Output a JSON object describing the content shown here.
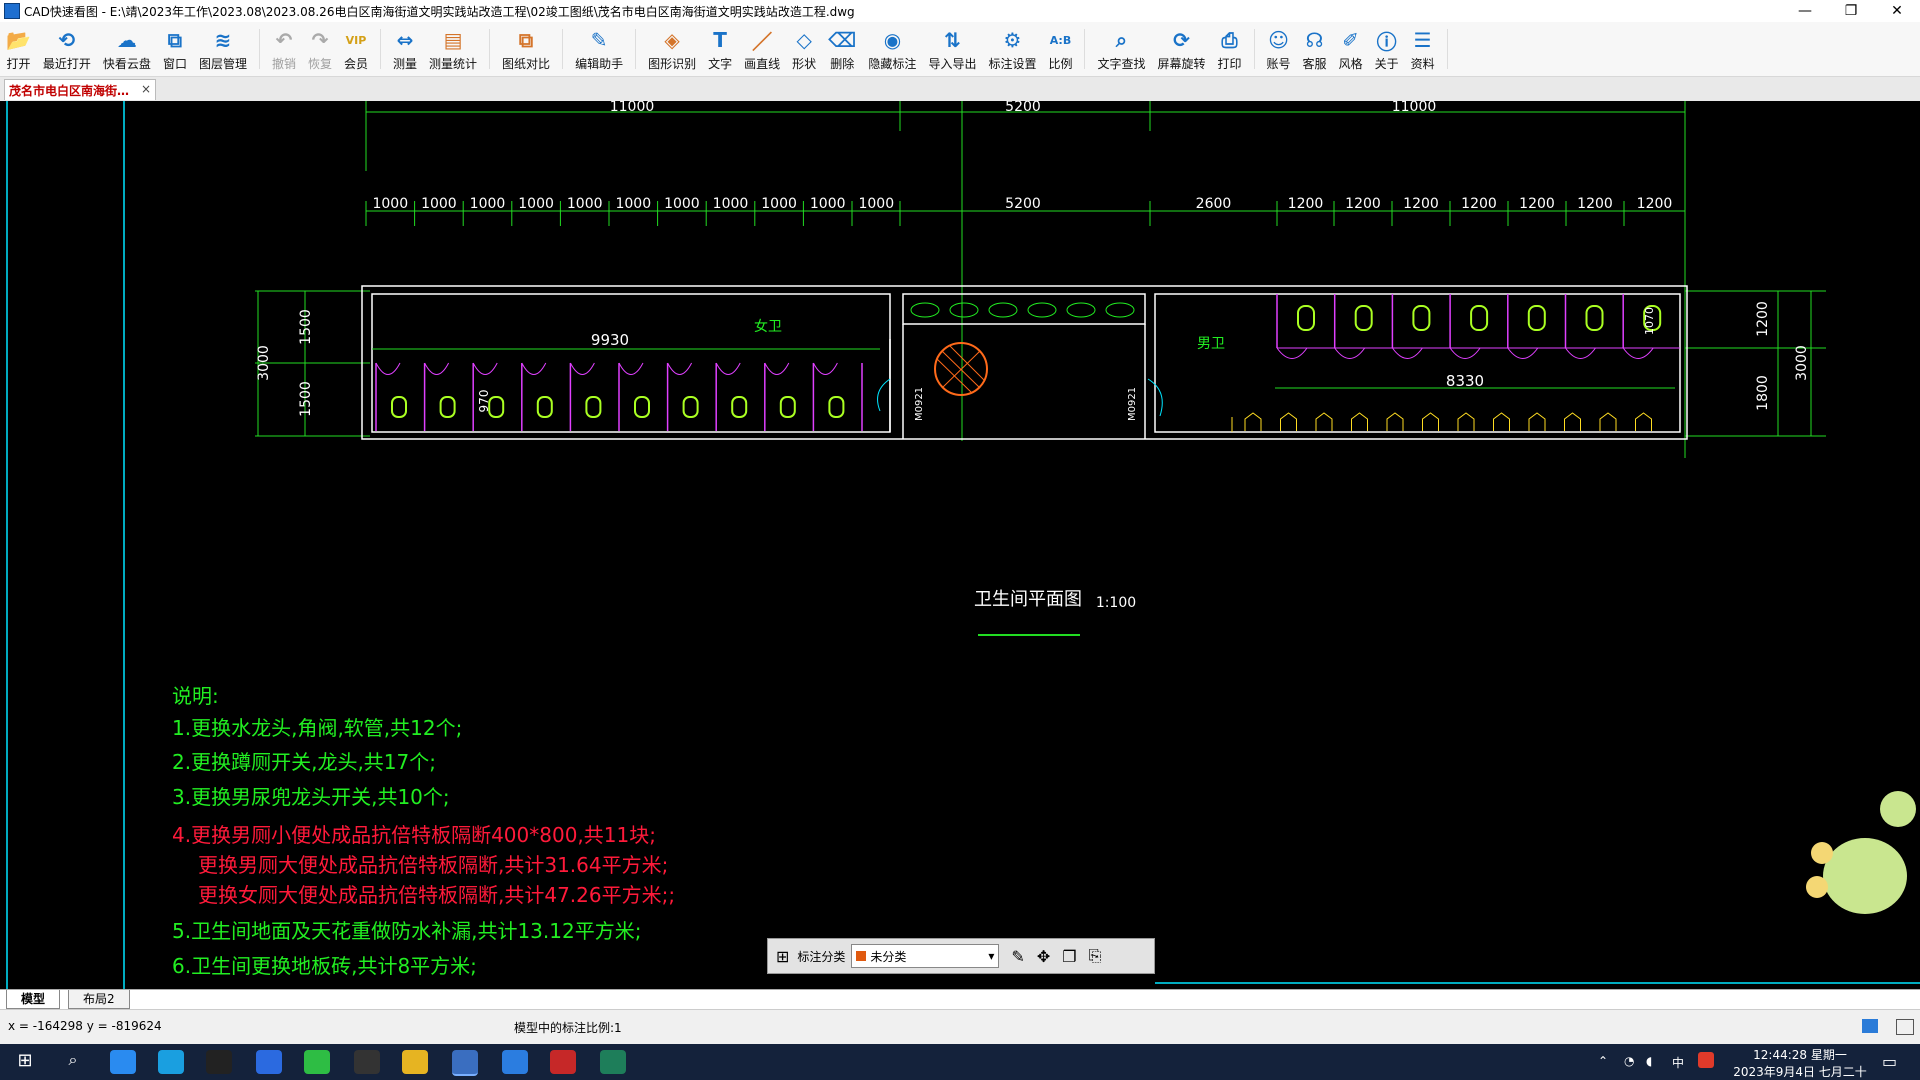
{
  "window": {
    "title": "CAD快速看图 - E:\\靖\\2023年工作\\2023.08\\2023.08.26电白区南海街道文明实践站改造工程\\02竣工图纸\\茂名市电白区南海街道文明实践站改造工程.dwg",
    "minimize": "—",
    "restore": "❐",
    "close": "✕"
  },
  "toolbar": {
    "items": [
      {
        "label": "打开",
        "icon": "folder-open-icon",
        "color": "#1a73c8"
      },
      {
        "label": "最近打开",
        "icon": "recent-icon",
        "color": "#1a73c8"
      },
      {
        "label": "快看云盘",
        "icon": "cloud-icon",
        "color": "#1a73c8"
      },
      {
        "label": "窗口",
        "icon": "window-icon",
        "color": "#1a73c8"
      },
      {
        "label": "图层管理",
        "icon": "layers-icon",
        "color": "#1a73c8"
      },
      {
        "label": "撤销",
        "icon": "undo-icon",
        "color": "#aaaaaa"
      },
      {
        "label": "恢复",
        "icon": "redo-icon",
        "color": "#aaaaaa"
      },
      {
        "label": "会员",
        "icon": "vip-icon",
        "color": "#d4a017"
      },
      {
        "label": "测量",
        "icon": "measure-icon",
        "color": "#1a73c8"
      },
      {
        "label": "测量统计",
        "icon": "measure-stats-icon",
        "color": "#d4742a"
      },
      {
        "label": "图纸对比",
        "icon": "compare-icon",
        "color": "#d4742a"
      },
      {
        "label": "编辑助手",
        "icon": "edit-assistant-icon",
        "color": "#1a73c8"
      },
      {
        "label": "图形识别",
        "icon": "shape-recognize-icon",
        "color": "#d4742a"
      },
      {
        "label": "文字",
        "icon": "text-icon",
        "color": "#1a73c8"
      },
      {
        "label": "画直线",
        "icon": "line-icon",
        "color": "#d4742a"
      },
      {
        "label": "形状",
        "icon": "shape-icon",
        "color": "#1a73c8"
      },
      {
        "label": "删除",
        "icon": "eraser-icon",
        "color": "#1a73c8"
      },
      {
        "label": "隐藏标注",
        "icon": "hide-annotation-icon",
        "color": "#1a73c8"
      },
      {
        "label": "导入导出",
        "icon": "import-export-icon",
        "color": "#1a73c8"
      },
      {
        "label": "标注设置",
        "icon": "annotation-settings-icon",
        "color": "#1a73c8"
      },
      {
        "label": "比例",
        "icon": "scale-icon",
        "color": "#1a73c8"
      },
      {
        "label": "文字查找",
        "icon": "text-search-icon",
        "color": "#1a73c8"
      },
      {
        "label": "屏幕旋转",
        "icon": "screen-rotate-icon",
        "color": "#1a73c8"
      },
      {
        "label": "打印",
        "icon": "print-icon",
        "color": "#1a73c8"
      },
      {
        "label": "账号",
        "icon": "account-icon",
        "color": "#1a73c8"
      },
      {
        "label": "客服",
        "icon": "headset-icon",
        "color": "#1a73c8"
      },
      {
        "label": "风格",
        "icon": "style-icon",
        "color": "#1a73c8"
      },
      {
        "label": "关于",
        "icon": "info-icon",
        "color": "#1a73c8"
      },
      {
        "label": "资料",
        "icon": "docs-icon",
        "color": "#1a73c8"
      }
    ]
  },
  "doc_tab": {
    "label": "茂名市电白区南海街…",
    "close": "×"
  },
  "drawing": {
    "top_dims": [
      "11000",
      "5200",
      "11000"
    ],
    "women_dims": [
      "1000",
      "1000",
      "1000",
      "1000",
      "1000",
      "1000",
      "1000",
      "1000",
      "1000",
      "1000",
      "1000"
    ],
    "mid_dim": "5200",
    "men_dims": [
      "2600",
      "1200",
      "1200",
      "1200",
      "1200",
      "1200",
      "1200",
      "1200"
    ],
    "left_dims": {
      "total": "3000",
      "upper": "1500",
      "lower": "1500"
    },
    "right_dims": {
      "total": "3000",
      "upper": "1200",
      "lower": "1800"
    },
    "women_label": "女卫",
    "men_label": "男卫",
    "women_length": "9930",
    "men_length": "8330",
    "stall_small_dim": "970",
    "stall_small_dim2": "1070",
    "door1": "M0921",
    "door2": "M0921",
    "title": "卫生间平面图",
    "scale": "1:100",
    "notes_header": "说明:",
    "notes": [
      {
        "text": "1.更换水龙头,角阀,软管,共12个;",
        "color": "#22ee22"
      },
      {
        "text": "2.更换蹲厕开关,龙头,共17个;",
        "color": "#22ee22"
      },
      {
        "text": "3.更换男尿兜龙头开关,共10个;",
        "color": "#22ee22"
      },
      {
        "text": "4.更换男厕小便处成品抗倍特板隔断400*800,共11块;",
        "color": "#ff1a3a"
      },
      {
        "text": "更换男厕大便处成品抗倍特板隔断,共计31.64平方米;",
        "color": "#ff1a3a"
      },
      {
        "text": "更换女厕大便处成品抗倍特板隔断,共计47.26平方米;;",
        "color": "#ff1a3a"
      },
      {
        "text": "5.卫生间地面及天花重做防水补漏,共计13.12平方米;",
        "color": "#22ee22"
      },
      {
        "text": "6.卫生间更换地板砖,共计8平方米;",
        "color": "#22ee22"
      }
    ]
  },
  "annotation_bar": {
    "label": "标注分类",
    "category": "未分类"
  },
  "layout_tabs": [
    "模型",
    "布局2"
  ],
  "status": {
    "coords": "x = -164298  y = -819624",
    "scale_text": "模型中的标注比例:1"
  },
  "taskbar": {
    "time": "12:44:28 星期一",
    "date": "2023年9月4日 七月二十",
    "ime": "中"
  }
}
